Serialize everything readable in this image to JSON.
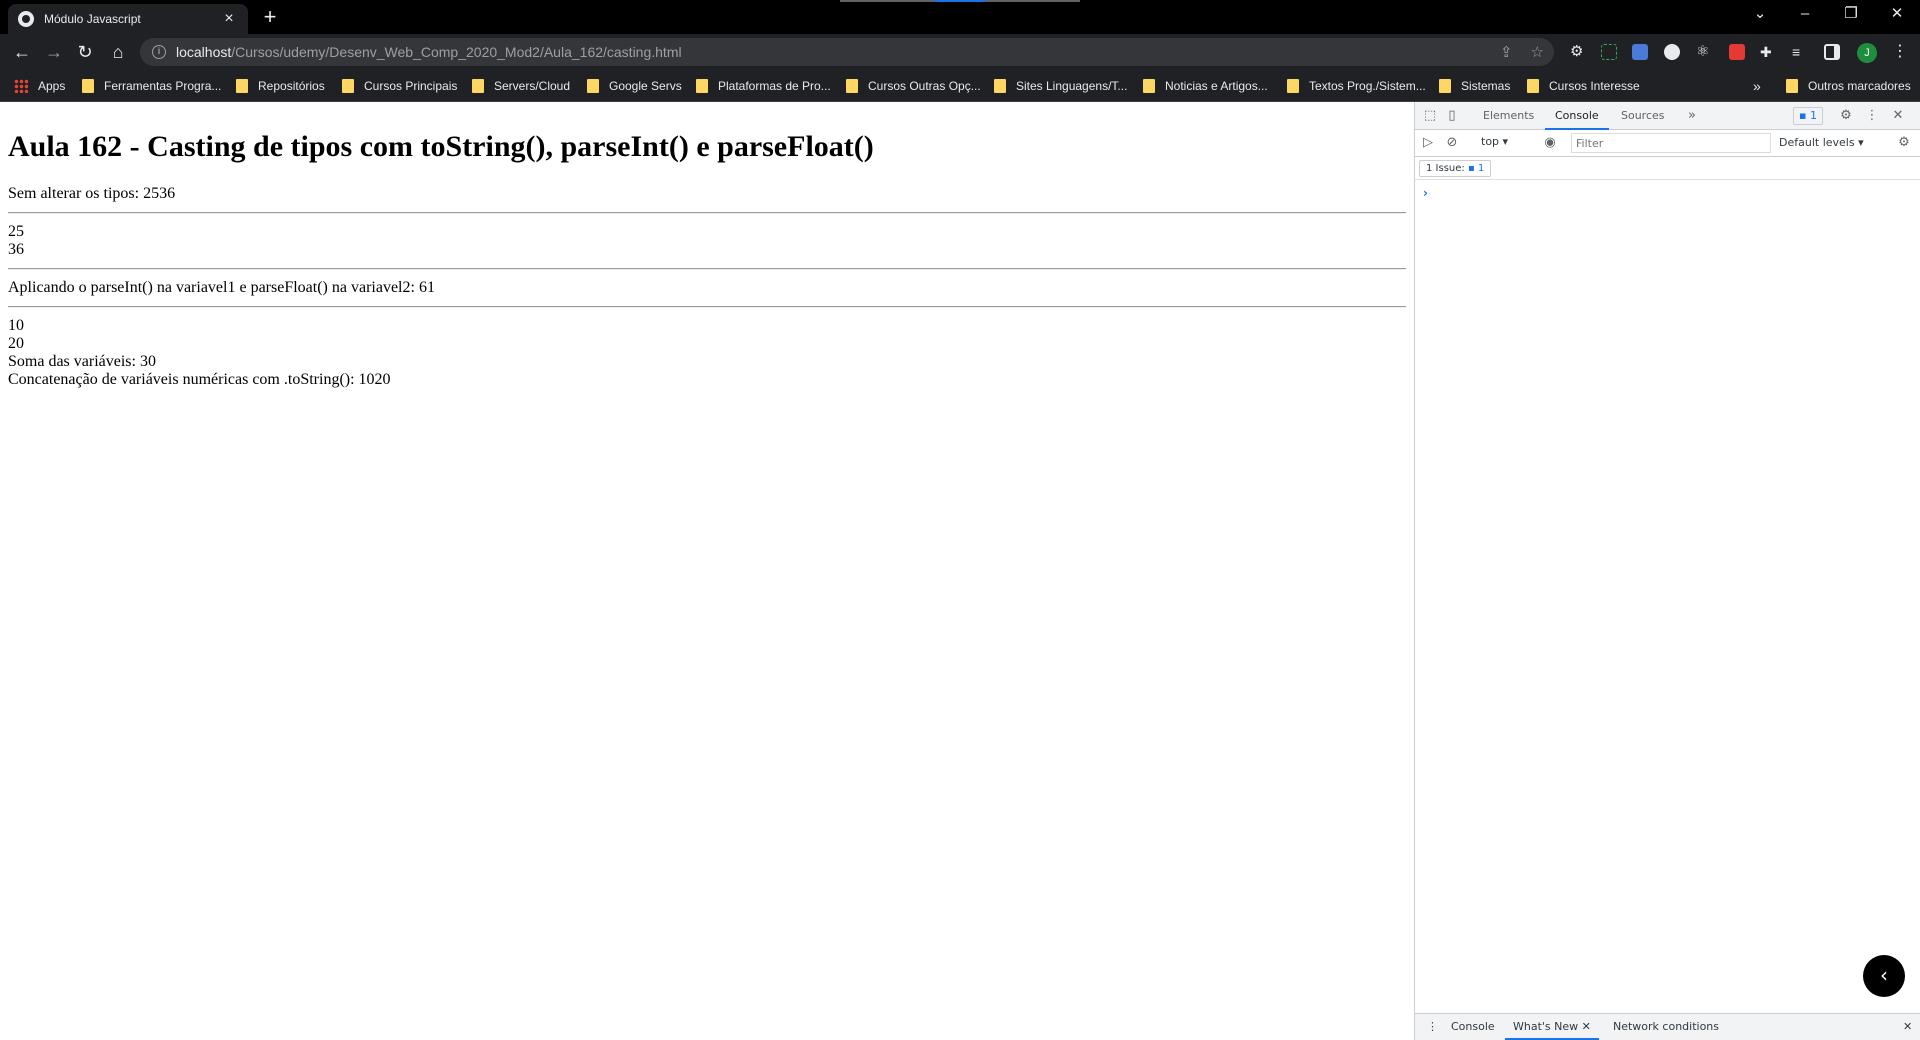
{
  "browser": {
    "tab_title": "Módulo Javascript",
    "url_host": "localhost",
    "url_path": "/Cursos/udemy/Desenv_Web_Comp_2020_Mod2/Aula_162/casting.html",
    "profile_initial": "J"
  },
  "bookmarks": {
    "apps": "Apps",
    "items": [
      "Ferramentas Progra...",
      "Repositórios",
      "Cursos Principais",
      "Servers/Cloud",
      "Google Servs",
      "Plataformas de Pro...",
      "Cursos Outras Opç...",
      "Sites Linguagens/T...",
      "Noticias e Artigos...",
      "Textos Prog./Sistem...",
      "Sistemas",
      "Cursos Interesse"
    ],
    "overflow": "»",
    "other": "Outros marcadores"
  },
  "page": {
    "heading": "Aula 162 - Casting de tipos com toString(), parseInt() e parseFloat()",
    "line1": "Sem alterar os tipos: 2536",
    "line2": "25",
    "line3": "36",
    "line4": "Aplicando o parseInt() na variavel1 e parseFloat() na variavel2: 61",
    "line5": "10",
    "line6": "20",
    "line7": "Soma das variáveis: 30",
    "line8": "Concatenação de variáveis numéricas com .toString(): 1020"
  },
  "devtools": {
    "tabs": [
      "Elements",
      "Console",
      "Sources"
    ],
    "active_tab": "Console",
    "issues_badge": "1",
    "context": "top",
    "filter_placeholder": "Filter",
    "levels": "Default levels",
    "issues_label": "1 Issue:",
    "issues_count": "1",
    "drawer_tabs": [
      "Console",
      "What's New",
      "Network conditions"
    ]
  },
  "colors": {
    "accent": "#1a73e8",
    "folder": "#fdd663",
    "chrome_dark": "#202124"
  }
}
